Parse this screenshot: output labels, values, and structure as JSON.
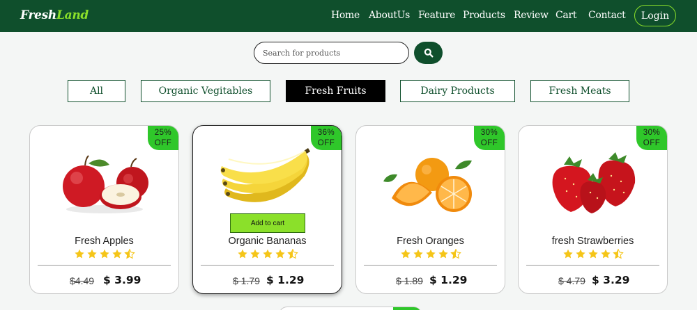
{
  "brand": {
    "word1": "Fresh",
    "word2": "Land"
  },
  "nav": {
    "links": [
      "Home",
      "AboutUs",
      "Feature",
      "Products",
      "Review",
      "Cart",
      "Contact"
    ],
    "login_label": "Login"
  },
  "search": {
    "placeholder": "Search for products",
    "button_icon": "search-icon"
  },
  "categories": [
    {
      "label": "All",
      "active": false
    },
    {
      "label": "Organic Vegitables",
      "active": false
    },
    {
      "label": "Fresh Fruits",
      "active": true
    },
    {
      "label": "Dairy Products",
      "active": false
    },
    {
      "label": "Fresh Meats",
      "active": false
    }
  ],
  "products": [
    {
      "name": "Fresh Apples",
      "discount_pct": "25%",
      "discount_word": "OFF",
      "old_price": "$4.49",
      "new_price": "$ 3.99",
      "rating": 4.5,
      "show_add_to_cart": false,
      "add_to_cart_label": ""
    },
    {
      "name": "Organic Bananas",
      "discount_pct": "36%",
      "discount_word": "OFF",
      "old_price": "$ 1.79",
      "new_price": "$ 1.29",
      "rating": 4.5,
      "show_add_to_cart": true,
      "add_to_cart_label": "Add to cart"
    },
    {
      "name": "Fresh Oranges",
      "discount_pct": "30%",
      "discount_word": "OFF",
      "old_price": "$ 1.89",
      "new_price": "$ 1.29",
      "rating": 4.5,
      "show_add_to_cart": false,
      "add_to_cart_label": ""
    },
    {
      "name": "fresh Strawberries",
      "discount_pct": "30%",
      "discount_word": "OFF",
      "old_price": "$ 4.79",
      "new_price": "$ 3.29",
      "rating": 4.5,
      "show_add_to_cart": false,
      "add_to_cart_label": ""
    }
  ],
  "colors": {
    "header_bg": "#0f4f2c",
    "accent_green": "#8be02a",
    "badge_green": "#2fc72a",
    "star_yellow": "#f5c518",
    "active_category_bg": "#000000"
  }
}
